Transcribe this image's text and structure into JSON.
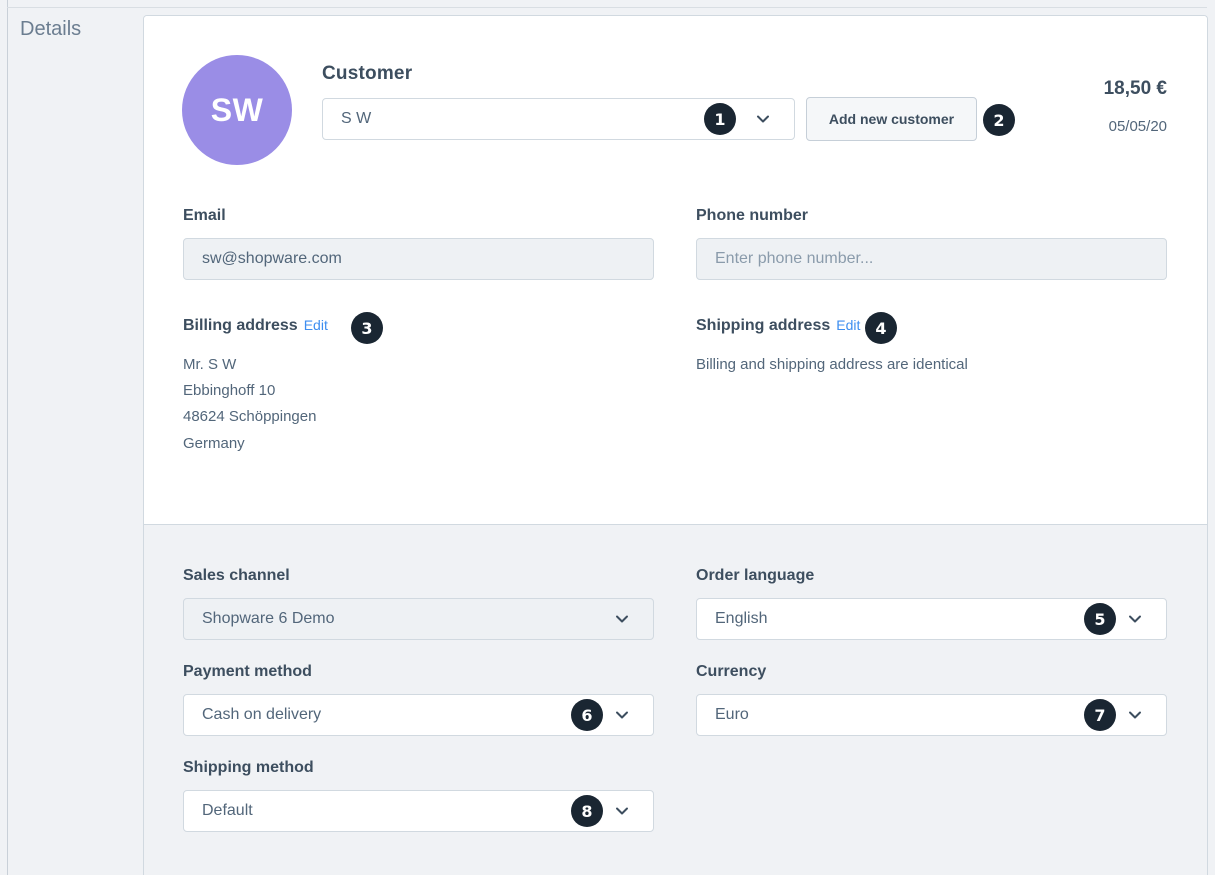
{
  "section": {
    "title": "Details"
  },
  "customer": {
    "avatar_initials": "SW",
    "avatar_color": "#9a8de6",
    "title": "Customer",
    "selected": "S W",
    "add_button_label": "Add new customer",
    "total": "18,50 €",
    "date": "05/05/20"
  },
  "contact": {
    "email_label": "Email",
    "email_value": "sw@shopware.com",
    "phone_label": "Phone number",
    "phone_placeholder": "Enter phone number..."
  },
  "billing": {
    "label": "Billing address",
    "edit_label": "Edit",
    "lines": [
      "Mr. S W",
      "Ebbinghoff 10",
      "48624 Schöppingen",
      "Germany"
    ]
  },
  "shipping": {
    "label": "Shipping address",
    "edit_label": "Edit",
    "note": "Billing and shipping address are identical"
  },
  "settings": {
    "sales_channel_label": "Sales channel",
    "sales_channel_value": "Shopware 6 Demo",
    "order_language_label": "Order language",
    "order_language_value": "English",
    "payment_method_label": "Payment method",
    "payment_method_value": "Cash on delivery",
    "currency_label": "Currency",
    "currency_value": "Euro",
    "shipping_method_label": "Shipping method",
    "shipping_method_value": "Default"
  },
  "badges": [
    "1",
    "2",
    "3",
    "4",
    "5",
    "6",
    "7",
    "8"
  ],
  "colors": {
    "link": "#3d8ef0",
    "badge": "#1a2632",
    "panel_bg": "#f0f2f5"
  }
}
